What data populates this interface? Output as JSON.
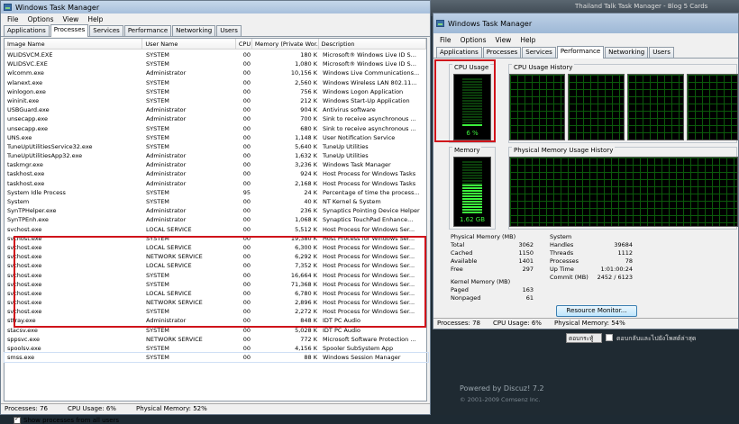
{
  "background_page": {
    "top_text": "Thailand Talk   Task Manager - Blog   5 Cards",
    "input_value": "ตอบกระทู้",
    "checkbox_label": "ตอบกลับและไปยังโพสต์ล่าสุด",
    "powered": "Powered by Discuz! 7.2",
    "copyright": "© 2001-2009 Comsenz Inc."
  },
  "window1": {
    "title": "Windows Task Manager",
    "menu": [
      "File",
      "Options",
      "View",
      "Help"
    ],
    "tabs": [
      "Applications",
      "Processes",
      "Services",
      "Performance",
      "Networking",
      "Users"
    ],
    "active_tab": 1,
    "columns": [
      "Image Name",
      "User Name",
      "CPU",
      "Memory (Private Wor...",
      "Description"
    ],
    "rows": [
      [
        "WLIDSVCM.EXE",
        "SYSTEM",
        "00",
        "180 K",
        "Microsoft® Windows Live ID S..."
      ],
      [
        "WLIDSVC.EXE",
        "SYSTEM",
        "00",
        "1,080 K",
        "Microsoft® Windows Live ID S..."
      ],
      [
        "wlcomm.exe",
        "Administrator",
        "00",
        "10,156 K",
        "Windows Live Communications..."
      ],
      [
        "wlanext.exe",
        "SYSTEM",
        "00",
        "2,560 K",
        "Windows Wireless LAN 802.11..."
      ],
      [
        "winlogon.exe",
        "SYSTEM",
        "00",
        "756 K",
        "Windows Logon Application"
      ],
      [
        "wininit.exe",
        "SYSTEM",
        "00",
        "212 K",
        "Windows Start-Up Application"
      ],
      [
        "USBGuard.exe",
        "Administrator",
        "00",
        "904 K",
        "Antivirus software"
      ],
      [
        "unsecapp.exe",
        "Administrator",
        "00",
        "700 K",
        "Sink to receive asynchronous ..."
      ],
      [
        "unsecapp.exe",
        "SYSTEM",
        "00",
        "680 K",
        "Sink to receive asynchronous ..."
      ],
      [
        "UNS.exe",
        "SYSTEM",
        "00",
        "1,148 K",
        "User Notification Service"
      ],
      [
        "TuneUpUtilitiesService32.exe",
        "SYSTEM",
        "00",
        "5,640 K",
        "TuneUp Utilities"
      ],
      [
        "TuneUpUtilitiesApp32.exe",
        "Administrator",
        "00",
        "1,632 K",
        "TuneUp Utilities"
      ],
      [
        "taskmgr.exe",
        "Administrator",
        "00",
        "3,236 K",
        "Windows Task Manager"
      ],
      [
        "taskhost.exe",
        "Administrator",
        "00",
        "924 K",
        "Host Process for Windows Tasks"
      ],
      [
        "taskhost.exe",
        "Administrator",
        "00",
        "2,168 K",
        "Host Process for Windows Tasks"
      ],
      [
        "System Idle Process",
        "SYSTEM",
        "95",
        "24 K",
        "Percentage of time the process..."
      ],
      [
        "System",
        "SYSTEM",
        "00",
        "40 K",
        "NT Kernel & System"
      ],
      [
        "SynTPHelper.exe",
        "Administrator",
        "00",
        "236 K",
        "Synaptics Pointing Device Helper"
      ],
      [
        "SynTPEnh.exe",
        "Administrator",
        "00",
        "1,068 K",
        "Synaptics TouchPad Enhance..."
      ],
      [
        "svchost.exe",
        "LOCAL SERVICE",
        "00",
        "5,512 K",
        "Host Process for Windows Ser..."
      ],
      [
        "svchost.exe",
        "SYSTEM",
        "00",
        "19,380 K",
        "Host Process for Windows Ser..."
      ],
      [
        "svchost.exe",
        "LOCAL SERVICE",
        "00",
        "6,300 K",
        "Host Process for Windows Ser..."
      ],
      [
        "svchost.exe",
        "NETWORK SERVICE",
        "00",
        "6,292 K",
        "Host Process for Windows Ser..."
      ],
      [
        "svchost.exe",
        "LOCAL SERVICE",
        "00",
        "7,352 K",
        "Host Process for Windows Ser..."
      ],
      [
        "svchost.exe",
        "SYSTEM",
        "00",
        "16,664 K",
        "Host Process for Windows Ser..."
      ],
      [
        "svchost.exe",
        "SYSTEM",
        "00",
        "71,368 K",
        "Host Process for Windows Ser..."
      ],
      [
        "svchost.exe",
        "LOCAL SERVICE",
        "00",
        "6,780 K",
        "Host Process for Windows Ser..."
      ],
      [
        "svchost.exe",
        "NETWORK SERVICE",
        "00",
        "2,896 K",
        "Host Process for Windows Ser..."
      ],
      [
        "svchost.exe",
        "SYSTEM",
        "00",
        "2,272 K",
        "Host Process for Windows Ser..."
      ],
      [
        "sttray.exe",
        "Administrator",
        "00",
        "848 K",
        "IDT PC Audio"
      ],
      [
        "stacsv.exe",
        "SYSTEM",
        "00",
        "5,028 K",
        "IDT PC Audio"
      ],
      [
        "sppsvc.exe",
        "NETWORK SERVICE",
        "00",
        "772 K",
        "Microsoft Software Protection ..."
      ],
      [
        "spoolsv.exe",
        "SYSTEM",
        "00",
        "4,156 K",
        "Spooler SubSystem App"
      ],
      [
        "smss.exe",
        "SYSTEM",
        "00",
        "88 K",
        "Windows Session Manager"
      ]
    ],
    "show_all_label": "Show processes from all users",
    "status": {
      "processes": "Processes: 76",
      "cpu": "CPU Usage: 6%",
      "memory": "Physical Memory: 52%"
    }
  },
  "window2": {
    "title": "Windows Task Manager",
    "menu": [
      "File",
      "Options",
      "View",
      "Help"
    ],
    "tabs": [
      "Applications",
      "Processes",
      "Services",
      "Performance",
      "Networking",
      "Users"
    ],
    "active_tab": 3,
    "cpu_usage_label": "CPU Usage",
    "cpu_usage_value": "6 %",
    "cpu_fraction": 0.06,
    "cpu_history_label": "CPU Usage History",
    "memory_label": "Memory",
    "memory_value": "1.62 GB",
    "memory_fraction": 0.54,
    "mem_history_label": "Physical Memory Usage History",
    "physical_memory": {
      "title": "Physical Memory (MB)",
      "items": [
        [
          "Total",
          "3062"
        ],
        [
          "Cached",
          "1150"
        ],
        [
          "Available",
          "1401"
        ],
        [
          "Free",
          "297"
        ]
      ]
    },
    "kernel_memory": {
      "title": "Kernel Memory (MB)",
      "items": [
        [
          "Paged",
          "163"
        ],
        [
          "Nonpaged",
          "61"
        ]
      ]
    },
    "system": {
      "title": "System",
      "items": [
        [
          "Handles",
          "39684"
        ],
        [
          "Threads",
          "1112"
        ],
        [
          "Processes",
          "78"
        ],
        [
          "Up Time",
          "1:01:00:24"
        ],
        [
          "Commit (MB)",
          "2452 / 6123"
        ]
      ]
    },
    "resource_monitor_label": "Resource Monitor...",
    "status": {
      "processes": "Processes: 78",
      "cpu": "CPU Usage: 6%",
      "memory": "Physical Memory: 54%"
    }
  },
  "colors": {
    "highlight_box": "#d0141b",
    "meter_green": "#3cf03c"
  }
}
